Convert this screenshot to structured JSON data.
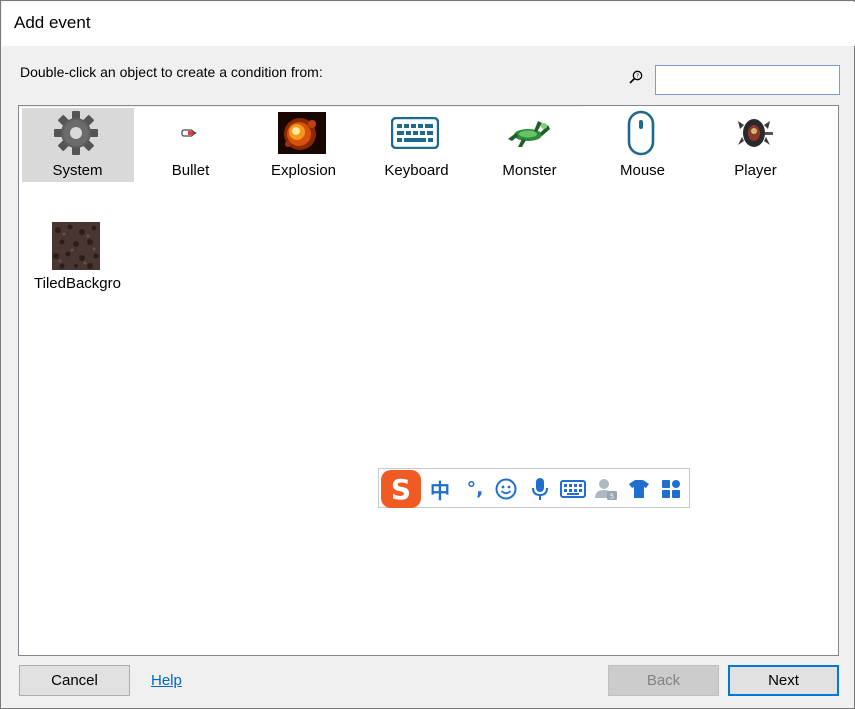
{
  "window": {
    "title": "Add event"
  },
  "instruction": "Double-click an object to create a condition from:",
  "search": {
    "value": "",
    "placeholder": ""
  },
  "objects": [
    {
      "label": "System",
      "icon": "gear-icon",
      "selected": true
    },
    {
      "label": "Bullet",
      "icon": "bullet-icon",
      "selected": false
    },
    {
      "label": "Explosion",
      "icon": "explosion-icon",
      "selected": false
    },
    {
      "label": "Keyboard",
      "icon": "keyboard-icon",
      "selected": false
    },
    {
      "label": "Monster",
      "icon": "monster-icon",
      "selected": false
    },
    {
      "label": "Mouse",
      "icon": "mouse-icon",
      "selected": false
    },
    {
      "label": "Player",
      "icon": "player-icon",
      "selected": false
    },
    {
      "label": "TiledBackgro",
      "icon": "tiled-background-icon",
      "selected": false
    }
  ],
  "ime_toolbar": {
    "logo": "S",
    "lang": "中",
    "punct": "°,",
    "items": [
      "ime-logo-icon",
      "chinese-mode-icon",
      "punctuation-icon",
      "emoji-icon",
      "microphone-icon",
      "keyboard-icon",
      "user-icon",
      "skin-icon",
      "grid-menu-icon"
    ]
  },
  "buttons": {
    "cancel": "Cancel",
    "help": "Help",
    "back": "Back",
    "next": "Next"
  },
  "colors": {
    "selection": "#d9d9d9",
    "link": "#0066cc",
    "default_button_border": "#0078d7",
    "ime_accent": "#f05a23",
    "ime_icons": "#1e6fd0"
  }
}
